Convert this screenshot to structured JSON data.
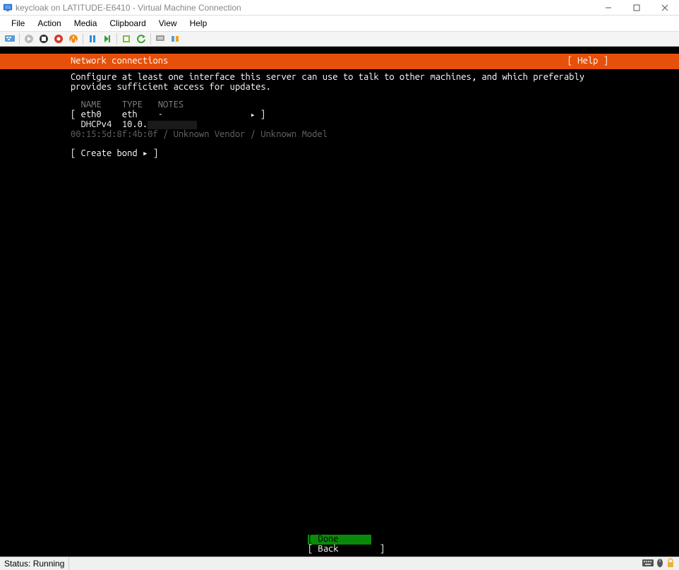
{
  "window": {
    "title": "keycloak on LATITUDE-E6410 - Virtual Machine Connection"
  },
  "menubar": [
    "File",
    "Action",
    "Media",
    "Clipboard",
    "View",
    "Help"
  ],
  "installer": {
    "header_title": "Network connections",
    "header_help": "[ Help ]",
    "instructions": "Configure at least one interface this server can use to talk to other machines, and which preferably provides sufficient access for updates.",
    "table": {
      "head_name": "NAME",
      "head_type": "TYPE",
      "head_notes": "NOTES",
      "row_name": "eth0",
      "row_type": "eth",
      "row_notes": "-",
      "row_dhcp_label": "DHCPv4",
      "row_dhcp_ip_prefix": "10.0.",
      "row_mac_line": "00:15:5d:8f:4b:0f / Unknown Vendor / Unknown Model"
    },
    "create_bond": "[ Create bond ▸ ]",
    "footer_done": "[ Done        ]",
    "footer_back": "[ Back        ]"
  },
  "status": {
    "label": "Status: Running"
  }
}
